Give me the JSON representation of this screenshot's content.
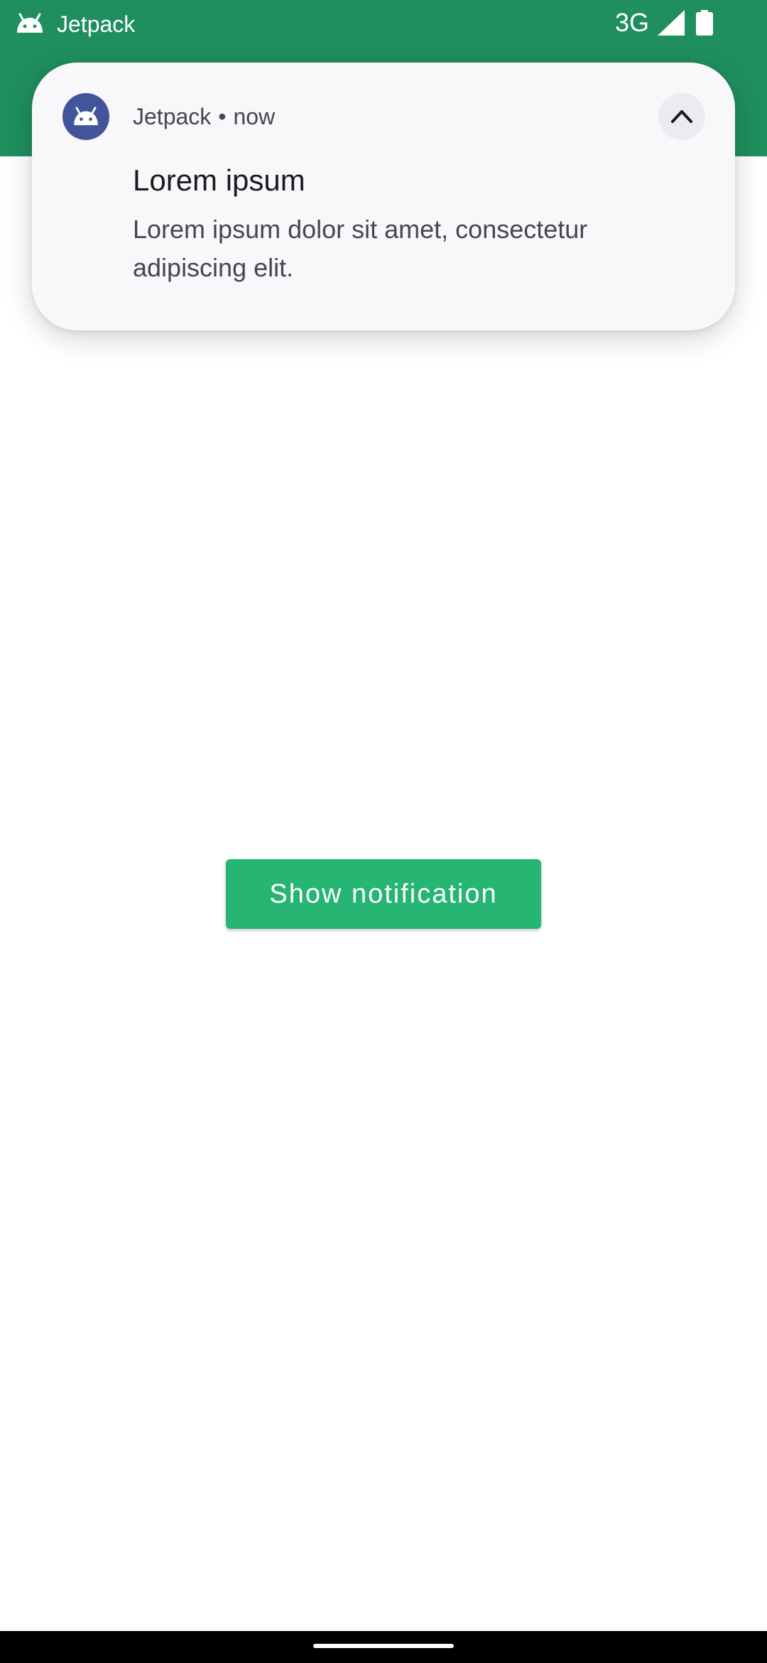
{
  "status_bar": {
    "app_name": "Jetpack",
    "network": "3G",
    "icons": [
      "android-icon",
      "signal-icon",
      "battery-icon"
    ],
    "background_color": "#1f8f5f"
  },
  "notification": {
    "app_name": "Jetpack",
    "separator": "•",
    "time": "now",
    "title": "Lorem ipsum",
    "body": "Lorem ipsum dolor sit amet, consectetur adipiscing elit.",
    "app_icon": "android-icon",
    "app_icon_color": "#43559a",
    "expand_icon": "chevron-up-icon"
  },
  "main": {
    "button_label": "Show notification",
    "button_color": "#27b573"
  },
  "nav_bar": {
    "handle": "gesture-handle"
  }
}
